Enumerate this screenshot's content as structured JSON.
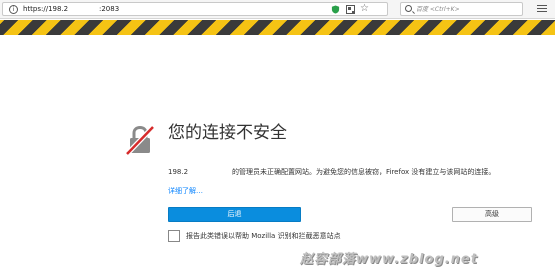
{
  "address_bar": {
    "host": "https://198.2",
    "port": ":2083"
  },
  "search": {
    "placeholder": "百度 <Ctrl+K>"
  },
  "error": {
    "title": "您的连接不安全",
    "host_prefix": "198.2",
    "description": "的管理员未正确配置网站。为避免您的信息被窃，Firefox 没有建立与该网站的连接。",
    "learn_more": "详细了解…"
  },
  "buttons": {
    "back_label": "后退",
    "advanced_label": "高级"
  },
  "report": {
    "label": "报告此类错误以帮助 Mozilla 识别和拦截恶意站点",
    "checked": false
  },
  "watermark": {
    "text": "赵容部落www.zblog.net"
  },
  "colors": {
    "stripe_yellow": "#f5c314",
    "stripe_dark": "#3a3a3a",
    "primary_button": "#0a8dde",
    "link": "#0a84ff",
    "lock_slash": "#d62b2b"
  }
}
